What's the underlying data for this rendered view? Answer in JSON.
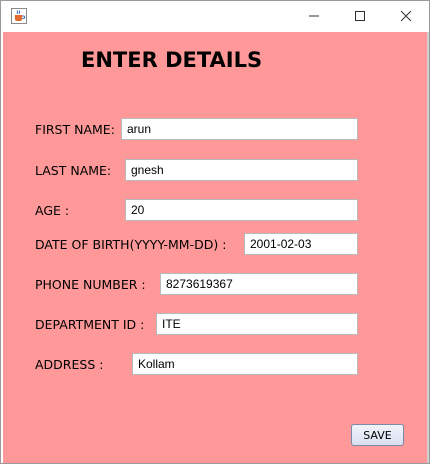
{
  "window": {
    "app_icon": "java-cup-icon",
    "controls": {
      "minimize_icon": "minimize-icon",
      "maximize_icon": "maximize-icon",
      "close_icon": "close-icon"
    }
  },
  "form": {
    "heading": "ENTER DETAILS",
    "background_color": "#ff9999",
    "fields": {
      "first_name": {
        "label": "FIRST NAME:",
        "value": "arun"
      },
      "last_name": {
        "label": "LAST NAME:",
        "value": "gnesh"
      },
      "age": {
        "label": "AGE :",
        "value": "20"
      },
      "dob": {
        "label": "DATE OF BIRTH(YYYY-MM-DD) :",
        "value": "2001-02-03"
      },
      "phone": {
        "label": "PHONE NUMBER :",
        "value": "8273619367"
      },
      "department": {
        "label": "DEPARTMENT ID :",
        "value": "ITE"
      },
      "address": {
        "label": "ADDRESS :",
        "value": "Kollam"
      }
    },
    "save_label": "SAVE"
  }
}
